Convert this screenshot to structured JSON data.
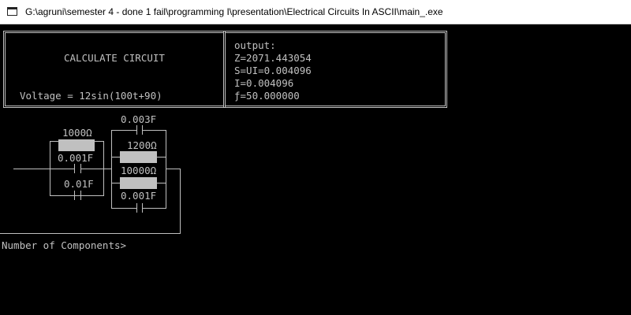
{
  "window": {
    "title": "G:\\agruni\\semester 4 - done 1 fail\\programming I\\presentation\\Electrical Circuits In ASCII\\main_.exe",
    "icon": "console-app-icon"
  },
  "header": {
    "title": "CALCULATE CIRCUIT",
    "voltage": "Voltage = 12sin(100t+90)"
  },
  "output": {
    "label": "output:",
    "lines": [
      "Z=2071.443054",
      "S=UI=0.004096",
      "I=0.004096",
      "ƒ=50.000000"
    ]
  },
  "circuit": {
    "left_resistor_label": "1000Ω",
    "left_cap_top_label": "0.001F",
    "left_cap_bottom_label": "0.01F",
    "right_top_cap_label": "0.003F",
    "right_resistor_1_label": "1200Ω",
    "right_resistor_2_label": "10000Ω",
    "right_bottom_cap_label": "0.001F"
  },
  "prompt": {
    "text": "Number of Components>"
  }
}
